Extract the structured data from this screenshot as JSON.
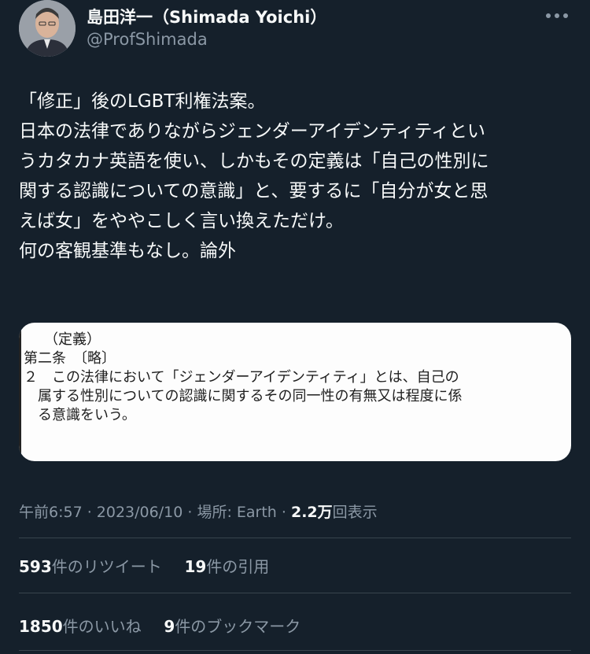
{
  "author": {
    "name": "島田洋一（Shimada Yoichi）",
    "handle": "@ProfShimada",
    "avatar_icon": "person-portrait-icon"
  },
  "more_icon": "more-dots-icon",
  "tweet": {
    "lines": [
      "「修正」後のLGBT利権法案。",
      "日本の法律でありながらジェンダーアイデンティティとい",
      "うカタカナ英語を使い、しかもその定義は「自己の性別に",
      "関する認識についての意識」と、要するに「自分が女と思",
      "えば女」をややこしく言い換えただけ。",
      "何の客観基準もなし。論外"
    ]
  },
  "media": {
    "doc_lines": [
      "（定義）",
      "第二条　〔略〕",
      "２　この法律において「ジェンダーアイデンティティ」とは、自己の",
      "　属する性別についての認識に関するその同一性の有無又は程度に係",
      "　る意識をいう。"
    ]
  },
  "meta": {
    "time": "午前6:57",
    "date": "2023/06/10",
    "location": "場所: Earth",
    "views_value": "2.2万",
    "views_label": "回表示",
    "sep": " · "
  },
  "stats": {
    "retweets_count": "593",
    "retweets_label": "件のリツイート",
    "quotes_count": "19",
    "quotes_label": "件の引用",
    "likes_count": "1850",
    "likes_label": "件のいいね",
    "bookmarks_count": "9",
    "bookmarks_label": "件のブックマーク"
  }
}
